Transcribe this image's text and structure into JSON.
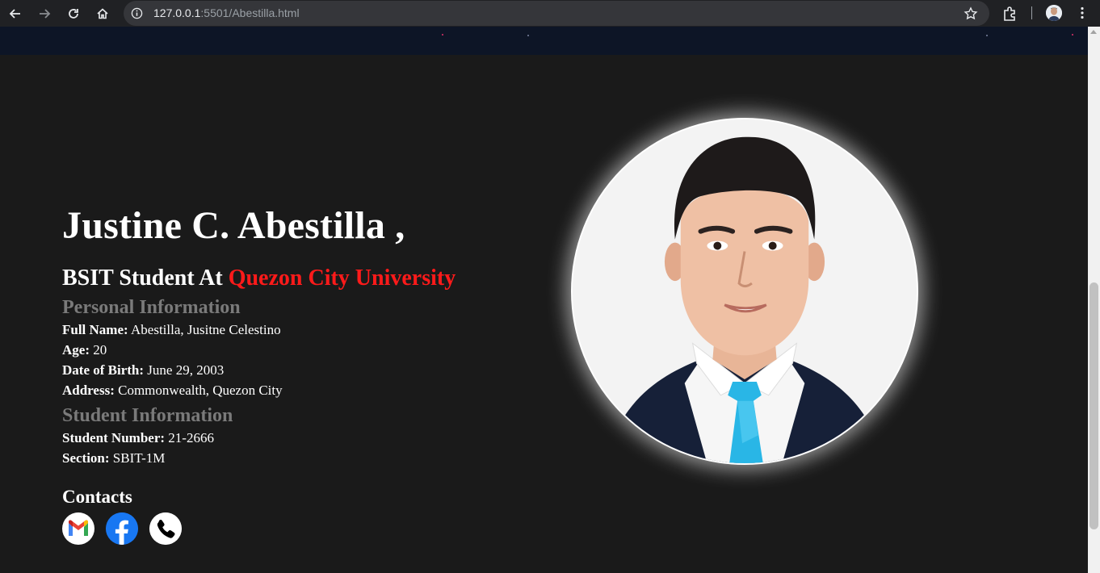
{
  "browser": {
    "url_host": "127.0.0.1",
    "url_rest": ":5501/Abestilla.html"
  },
  "hero": {
    "name": "Justine C. Abestilla ,",
    "subtitle_prefix": "BSIT Student At ",
    "university": "Quezon City University"
  },
  "personal": {
    "title": "Personal Information",
    "fields": [
      {
        "label": "Full Name:",
        "value": " Abestilla, Jusitne Celestino"
      },
      {
        "label": "Age:",
        "value": " 20"
      },
      {
        "label": "Date of Birth:",
        "value": " June 29, 2003"
      },
      {
        "label": "Address:",
        "value": " Commonwealth, Quezon City"
      }
    ]
  },
  "student": {
    "title": "Student Information",
    "fields": [
      {
        "label": "Student Number:",
        "value": " 21-2666"
      },
      {
        "label": "Section:",
        "value": " SBIT-1M"
      }
    ]
  },
  "contacts": {
    "title": "Contacts",
    "icons": [
      "gmail-icon",
      "facebook-icon",
      "phone-icon"
    ]
  },
  "colors": {
    "accent": "#ff1a1a",
    "section_title": "#7a7a7a",
    "background": "#1a1a1a",
    "navbar": "#0d1526"
  }
}
